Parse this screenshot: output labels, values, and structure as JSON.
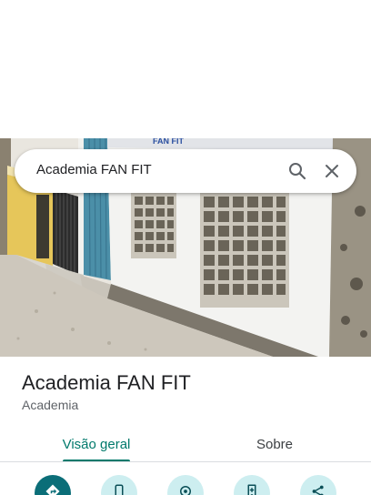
{
  "search": {
    "query": "Academia FAN FIT",
    "search_icon": "search-icon",
    "close_icon": "close-icon"
  },
  "place": {
    "name": "Academia FAN FIT",
    "category": "Academia"
  },
  "tabs": [
    {
      "label": "Visão geral",
      "selected": true
    },
    {
      "label": "Sobre",
      "selected": false
    }
  ],
  "actions": [
    {
      "icon": "directions-icon"
    },
    {
      "icon": "phone-icon"
    },
    {
      "icon": "start-navigation-icon"
    },
    {
      "icon": "save-icon"
    },
    {
      "icon": "share-icon"
    }
  ],
  "colors": {
    "accent": "#00796b",
    "action_primary": "#0b6e78",
    "action_secondary": "#cdeef0"
  }
}
